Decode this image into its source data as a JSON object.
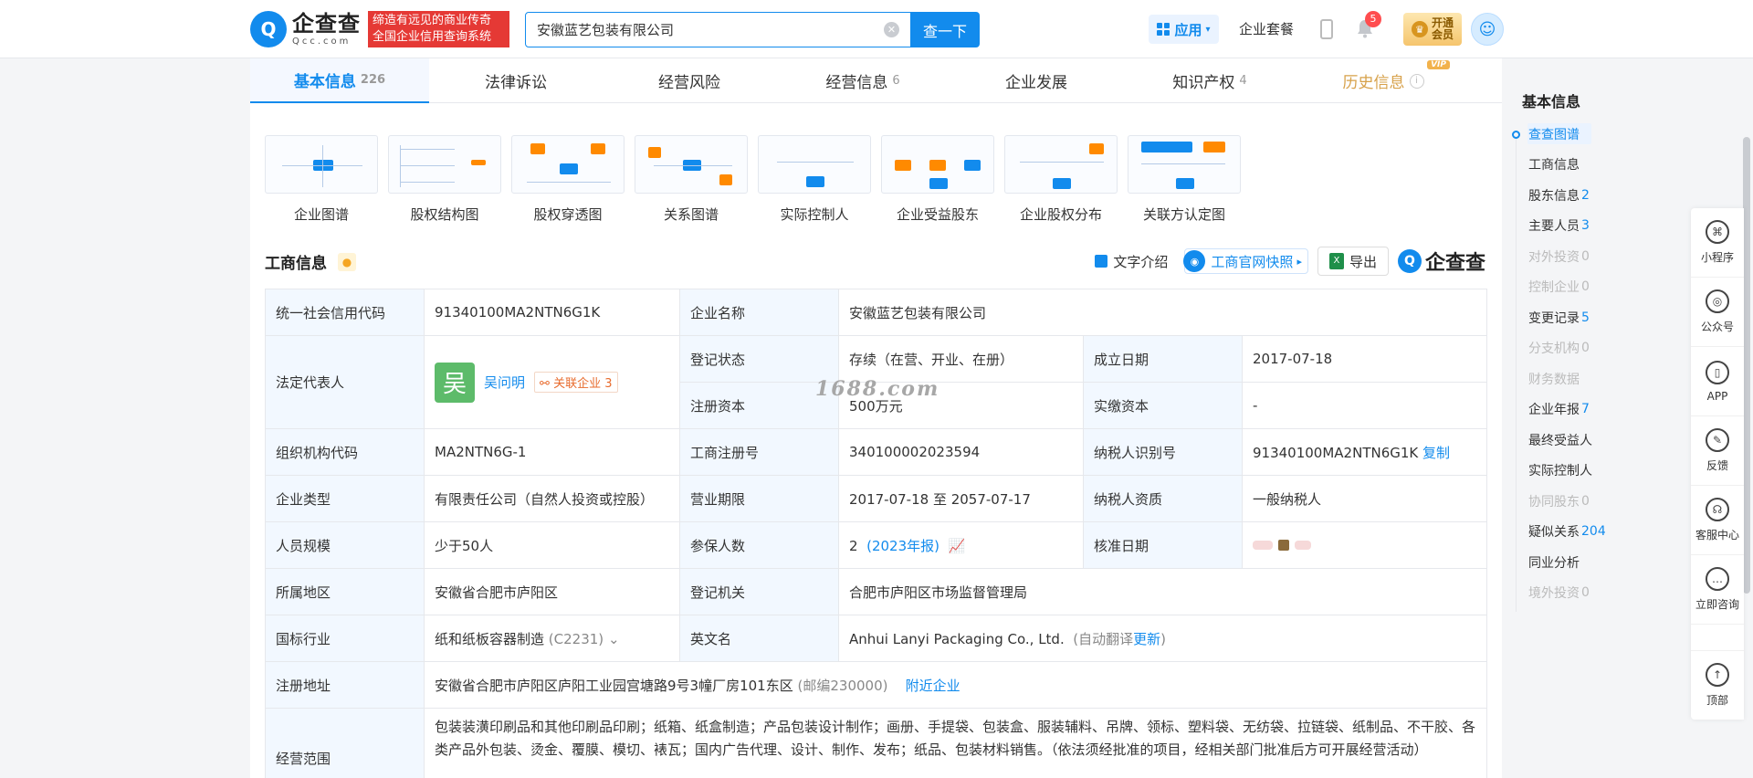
{
  "header": {
    "logo_cn": "企查查",
    "logo_en": "Qcc.com",
    "slogan_line1": "缔造有远见的商业传奇",
    "slogan_line2": "全国企业信用查询系统",
    "search_value": "安徽蓝艺包装有限公司",
    "search_button": "查一下",
    "app_label": "应用",
    "package_label": "企业套餐",
    "notification_count": "5",
    "vip_line1": "开通",
    "vip_line2": "会员"
  },
  "tabs": [
    {
      "label": "基本信息",
      "count": "226"
    },
    {
      "label": "法律诉讼",
      "count": ""
    },
    {
      "label": "经营风险",
      "count": ""
    },
    {
      "label": "经营信息",
      "count": "6"
    },
    {
      "label": "企业发展",
      "count": ""
    },
    {
      "label": "知识产权",
      "count": "4"
    },
    {
      "label": "历史信息",
      "count": "",
      "tag": "VIP"
    }
  ],
  "graphs": [
    {
      "label": "企业图谱"
    },
    {
      "label": "股权结构图"
    },
    {
      "label": "股权穿透图"
    },
    {
      "label": "关系图谱"
    },
    {
      "label": "实际控制人"
    },
    {
      "label": "企业受益股东"
    },
    {
      "label": "企业股权分布"
    },
    {
      "label": "关联方认定图"
    }
  ],
  "section": {
    "title": "工商信息",
    "text_intro": "文字介绍",
    "snapshot": "工商官网快照",
    "export": "导出",
    "brand": "企查查"
  },
  "info": {
    "credit_code_label": "统一社会信用代码",
    "credit_code": "91340100MA2NTN6G1K",
    "company_name_label": "企业名称",
    "company_name": "安徽蓝艺包装有限公司",
    "legal_rep_label": "法定代表人",
    "legal_rep_avatar": "吴",
    "legal_rep_name": "吴问明",
    "related_label": "关联企业",
    "related_count": "3",
    "reg_status_label": "登记状态",
    "reg_status": "存续（在营、开业、在册）",
    "found_date_label": "成立日期",
    "found_date": "2017-07-18",
    "reg_capital_label": "注册资本",
    "reg_capital": "500万元",
    "paid_capital_label": "实缴资本",
    "paid_capital": "-",
    "org_code_label": "组织机构代码",
    "org_code": "MA2NTN6G-1",
    "biz_reg_no_label": "工商注册号",
    "biz_reg_no": "340100002023594",
    "tax_id_label": "纳税人识别号",
    "tax_id": "91340100MA2NTN6G1K",
    "copy_label": "复制",
    "type_label": "企业类型",
    "type": "有限责任公司（自然人投资或控股）",
    "term_label": "营业期限",
    "term": "2017-07-18 至 2057-07-17",
    "tax_quality_label": "纳税人资质",
    "tax_quality": "一般纳税人",
    "staff_label": "人员规模",
    "staff": "少于50人",
    "insured_label": "参保人数",
    "insured": "2",
    "insured_year": "(2023年报)",
    "approve_label": "核准日期",
    "region_label": "所属地区",
    "region": "安徽省合肥市庐阳区",
    "authority_label": "登记机关",
    "authority": "合肥市庐阳区市场监督管理局",
    "industry_label": "国标行业",
    "industry": "纸和纸板容器制造",
    "industry_code": "(C2231)",
    "en_name_label": "英文名",
    "en_name": "Anhui Lanyi Packaging Co., Ltd.",
    "auto_translate": "(自动翻译",
    "update": "更新",
    "close_paren": ")",
    "address_label": "注册地址",
    "address": "安徽省合肥市庐阳区庐阳工业园宫塘路9号3幢厂房101东区",
    "postcode": "(邮编230000)",
    "nearby": "附近企业",
    "scope_label": "经营范围",
    "scope": "包装装潢印刷品和其他印刷品印刷；纸箱、纸盒制造；产品包装设计制作；画册、手提袋、包装盒、服装辅料、吊牌、领标、塑料袋、无纺袋、拉链袋、纸制品、不干胶、各类产品外包装、烫金、覆膜、模切、裱瓦；国内广告代理、设计、制作、发布；纸品、包装材料销售。（依法须经批准的项目，经相关部门批准后方可开展经营活动）"
  },
  "watermark": "1688.com",
  "right_nav": {
    "title": "基本信息",
    "items": [
      {
        "label": "查查图谱",
        "count": "",
        "state": "active"
      },
      {
        "label": "工商信息",
        "count": "",
        "state": ""
      },
      {
        "label": "股东信息",
        "count": "2",
        "state": ""
      },
      {
        "label": "主要人员",
        "count": "3",
        "state": ""
      },
      {
        "label": "对外投资",
        "count": "0",
        "state": "dim"
      },
      {
        "label": "控制企业",
        "count": "0",
        "state": "dim"
      },
      {
        "label": "变更记录",
        "count": "5",
        "state": ""
      },
      {
        "label": "分支机构",
        "count": "0",
        "state": "dim"
      },
      {
        "label": "财务数据",
        "count": "",
        "state": "dim"
      },
      {
        "label": "企业年报",
        "count": "7",
        "state": ""
      },
      {
        "label": "最终受益人",
        "count": "",
        "state": ""
      },
      {
        "label": "实际控制人",
        "count": "",
        "state": ""
      },
      {
        "label": "协同股东",
        "count": "0",
        "state": "dim"
      },
      {
        "label": "疑似关系",
        "count": "204",
        "state": ""
      },
      {
        "label": "同业分析",
        "count": "",
        "state": ""
      },
      {
        "label": "境外投资",
        "count": "0",
        "state": "dim"
      }
    ]
  },
  "tools": [
    {
      "label": "小程序",
      "icon": "⌘"
    },
    {
      "label": "公众号",
      "icon": "◎"
    },
    {
      "label": "APP",
      "icon": "▯"
    },
    {
      "label": "反馈",
      "icon": "✎"
    },
    {
      "label": "客服中心",
      "icon": "☊"
    },
    {
      "label": "立即咨询",
      "icon": "…"
    },
    {
      "label": "顶部",
      "icon": "↑"
    }
  ]
}
